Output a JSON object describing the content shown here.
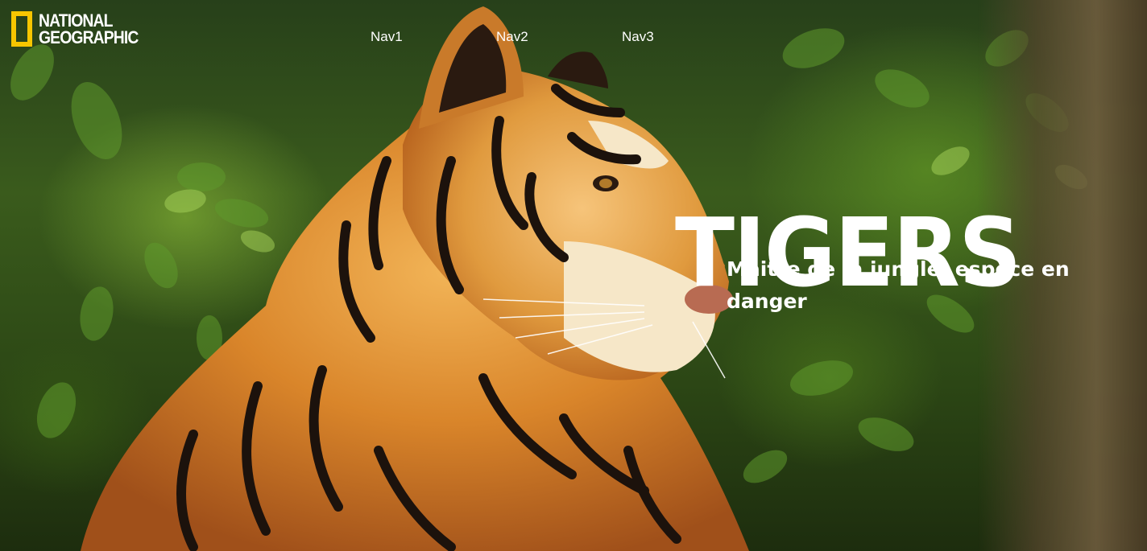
{
  "brand": {
    "line1": "NATIONAL",
    "line2": "GEOGRAPHIC",
    "frame_color": "#f7c600",
    "icon": "yellow-rectangle-logo-icon"
  },
  "nav": {
    "items": [
      {
        "label": "Nav1"
      },
      {
        "label": "Nav2"
      },
      {
        "label": "Nav3"
      }
    ]
  },
  "hero": {
    "title": "TIGERS",
    "subtitle": "Maitre de la jungle, espèce en danger",
    "image": "tiger-photo"
  }
}
